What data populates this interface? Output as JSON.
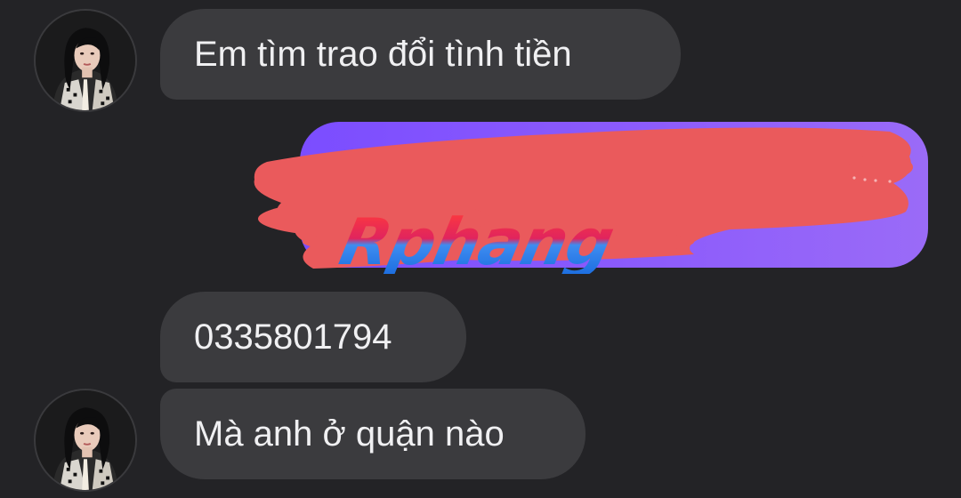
{
  "messages": [
    {
      "sender": "contact",
      "text": "Em tìm trao đổi tình tiền"
    },
    {
      "sender": "self",
      "text": ""
    },
    {
      "sender": "contact",
      "text": "0335801794"
    },
    {
      "sender": "contact",
      "text": "Mà anh ở quận nào"
    }
  ],
  "watermark": "Rphang",
  "colors": {
    "background": "#232326",
    "incoming_bubble": "#3b3b3e",
    "outgoing_bubble": "#8a5af9",
    "redaction": "#ea5a5c"
  },
  "icons": [
    "contact-avatar",
    "contact-avatar"
  ]
}
